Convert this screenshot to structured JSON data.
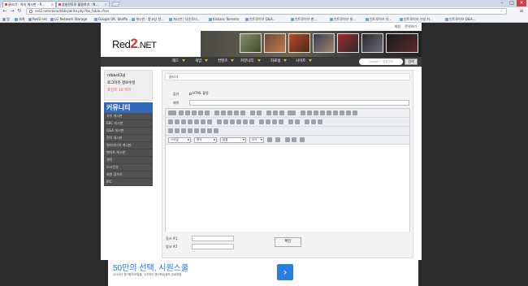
{
  "browser": {
    "tabs": [
      {
        "label": "글쓰기 - 자유 게시판 - R..."
      },
      {
        "label": "상설전투로 활용하기 - N..."
      }
    ],
    "url": "red2.net/cboard/bbs/write.php?bo_table=free",
    "bookmarks": [
      "앱",
      "세계",
      "Red2.net",
      "LG Network Storage",
      "Google UK, Sheffe...",
      "게시판 - 중고상 한...",
      "게시판 | 다운로더...",
      "Kickass Torrents",
      "인트로이브 Q&A...",
      "인트로이브 팬...",
      "인트로이브 빌...",
      "인트로이브 자...",
      "인트로이브 가설 커...",
      "인트로이브 Q&A..."
    ]
  },
  "site": {
    "toplinks": [
      "회원",
      "문의하기"
    ],
    "logo_pre": "Red",
    "logo_num": "2",
    "logo_post": ".NET",
    "menu": [
      "레드",
      "게임",
      "컨텐츠",
      "커뮤니티",
      "자료실",
      "사이트"
    ],
    "search_placeholder": "Google™ 맞춤검색",
    "search_button": "검색"
  },
  "sidebar": {
    "username": "rdbbs03님",
    "profile_link": "로그아웃 정보수정",
    "points": "포인트 10 쪽지",
    "category_title": "커뮤니티",
    "items": [
      "자유 게시판",
      "EBC 게시판",
      "Q&A 게시판",
      "전략 게시판",
      "멀티미디어 게시판",
      "팬아트 게시판",
      "갤럭",
      "스크린샷",
      "회원 접속자",
      "IRC"
    ]
  },
  "form": {
    "heading": "글쓰기",
    "option_label": "옵션",
    "html_label": "HTML 활용",
    "subject_label": "제목",
    "link1_label": "링크 #1",
    "link2_label": "링크 #2",
    "submit_label": "확인"
  },
  "editor": {
    "style_select": "스타일",
    "format_select": "형식",
    "font_select": "글꼴",
    "size_select": "크기"
  },
  "ad": {
    "title": "50만의 선택, 시원스쿨",
    "subtitle": "2015년 영어왕초보탈출, 3/3까지 영어학습캠프 무료증정",
    "arrow": "›"
  }
}
